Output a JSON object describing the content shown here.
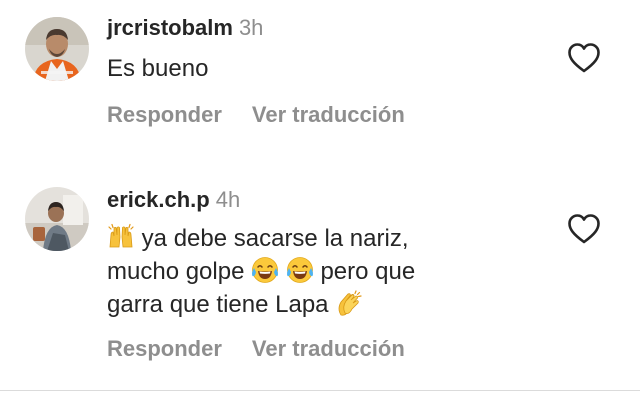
{
  "comments": [
    {
      "username": "jrcristobalm",
      "time": "3h",
      "avatar_icon": "user-photo-orange-vest",
      "text_lines": [
        "Es bueno"
      ],
      "actions": {
        "reply": "Responder",
        "translate": "Ver traducción"
      }
    },
    {
      "username": "erick.ch.p",
      "time": "4h",
      "avatar_icon": "user-photo-seated",
      "text": {
        "line1": "ya debe sacarse la nariz,",
        "line2a": "mucho golpe",
        "line2b": "pero que",
        "line3": "garra que tiene Lapa"
      },
      "emojis": [
        "raising-hands-emoji",
        "tears-of-joy-emoji",
        "tears-of-joy-emoji",
        "clapping-hands-emoji"
      ],
      "actions": {
        "reply": "Responder",
        "translate": "Ver traducción"
      }
    }
  ],
  "colors": {
    "primary_text": "#262626",
    "secondary_text": "#8e8e8e",
    "divider": "#dbdbdb"
  }
}
